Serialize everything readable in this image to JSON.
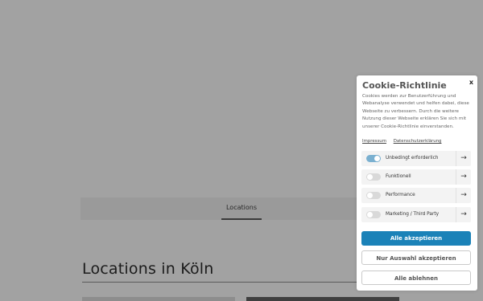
{
  "page": {
    "tab_label": "Locations",
    "section_title": "Locations in Köln"
  },
  "cookie": {
    "title": "Cookie-Richtlinie",
    "close_label": "x",
    "text": "Cookies werden zur Benutzerführung und Webanalyse verwendet und helfen dabei, diese Webseite zu verbessern. Durch die weitere Nutzung dieser Webseite erklären Sie sich mit unserer Cookie-Richtlinie einverstanden.",
    "links": [
      "Impressum",
      "Datenschutzerklärung"
    ],
    "options": [
      {
        "label": "Unbedingt erforderlich",
        "enabled": true
      },
      {
        "label": "Funktionell",
        "enabled": false
      },
      {
        "label": "Performance",
        "enabled": false
      },
      {
        "label": "Marketing / Third Party",
        "enabled": false
      }
    ],
    "arrow_icon": "arrow-right-icon",
    "buttons": {
      "accept_all": "Alle akzeptieren",
      "accept_selection": "Nur Auswahl akzeptieren",
      "reject_all": "Alle ablehnen"
    },
    "accent_color": "#1b82b8"
  }
}
